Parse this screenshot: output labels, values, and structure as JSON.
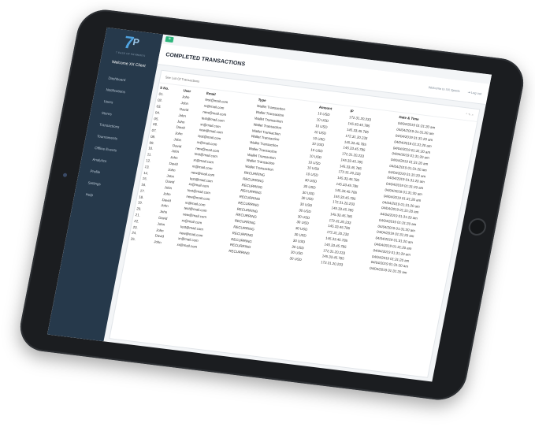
{
  "sidebar": {
    "logo_sub": "7 EASE OF PAYMENTS",
    "welcome": "Welcome XX Client",
    "items": [
      {
        "label": "Dashboard"
      },
      {
        "label": "Notifications"
      },
      {
        "label": "Users"
      },
      {
        "label": "Stores"
      },
      {
        "label": "Transactions"
      },
      {
        "label": "Tournaments"
      },
      {
        "label": "Offline Events"
      },
      {
        "label": "Analytics"
      },
      {
        "label": "Profile"
      },
      {
        "label": "Settings"
      },
      {
        "label": "Help"
      }
    ]
  },
  "header": {
    "title": "COMPLETED TRANSACTIONS",
    "welcome_user": "Welcome to XX Sports",
    "logout": "Log out"
  },
  "card": {
    "title": "See List Of Transactions",
    "tools": "^ ✎ ×"
  },
  "table": {
    "columns": [
      "S No.",
      "User",
      "Email",
      "Type",
      "Amount",
      "IP",
      "Date & Time"
    ],
    "rows": [
      [
        "01.",
        "John",
        "test@mail.com",
        "Wallet Transaction",
        "10 USD",
        "172.31.20.233",
        "04/04/2019 01:31:20 am"
      ],
      [
        "02.",
        "John",
        "xr@mail.com",
        "Wallet Transaction",
        "10 USD",
        "145.33.45.785",
        "04/04/2019 01:31:20 am"
      ],
      [
        "03.",
        "David",
        "new@mail.com",
        "Wallet Transaction",
        "10 USD",
        "145.33.45.785",
        "04/04/2019 01:31:20 am"
      ],
      [
        "04.",
        "John",
        "test@mail.com",
        "Wallet Transaction",
        "10 USD",
        "172.31.20.233",
        "04/04/2019 01:31:20 am"
      ],
      [
        "05.",
        "John",
        "xr@mail.com",
        "Wallet Transaction",
        "10 USD",
        "145.33.45.785",
        "04/04/2019 01:31:20 am"
      ],
      [
        "06.",
        "David",
        "new@mail.com",
        "Wallet Transaction",
        "10 USD",
        "145.33.45.785",
        "04/04/2019 01:31:20 am"
      ],
      [
        "07.",
        "John",
        "test@mail.com",
        "Wallet Transaction",
        "10 USD",
        "172.31.20.233",
        "04/04/2019 01:31:20 am"
      ],
      [
        "08.",
        "John",
        "xr@mail.com",
        "Wallet Transaction",
        "10 USD",
        "145.33.45.785",
        "04/04/2019 01:31:20 am"
      ],
      [
        "09.",
        "David",
        "new@mail.com",
        "Wallet Transaction",
        "10 USD",
        "145.33.45.785",
        "04/04/2019 01:31:20 am"
      ],
      [
        "10.",
        "John",
        "test@mail.com",
        "Wallet Transaction",
        "10 USD",
        "172.31.20.233",
        "04/04/2019 01:31:20 am"
      ],
      [
        "11.",
        "John",
        "xr@mail.com",
        "Wallet Transaction",
        "10 USD",
        "145.33.45.785",
        "04/04/2019 01:31:20 am"
      ],
      [
        "12.",
        "David",
        "xr@mail.com",
        "RECURRING",
        "30 USD",
        "145.33.45.785",
        "04/04/2019 01:31:20 am"
      ],
      [
        "13.",
        "John",
        "new@mail.com",
        "RECURRING",
        "30 USD",
        "145.33.45.785",
        "04/04/2019 01:31:20 am"
      ],
      [
        "14.",
        "John",
        "test@mail.com",
        "RECURRING",
        "30 USD",
        "145.33.45.785",
        "04/04/2019 01:31:20 am"
      ],
      [
        "15.",
        "David",
        "xr@mail.com",
        "RECURRING",
        "30 USD",
        "172.31.20.233",
        "04/04/2019 01:31:20 am"
      ],
      [
        "16.",
        "John",
        "test@mail.com",
        "RECURRING",
        "30 USD",
        "145.33.45.785",
        "04/04/2019 01:31:20 am"
      ],
      [
        "17.",
        "John",
        "new@mail.com",
        "RECURRING",
        "30 USD",
        "145.33.45.785",
        "04/04/2019 01:31:20 am"
      ],
      [
        "18.",
        "David",
        "xr@mail.com",
        "RECURRING",
        "30 USD",
        "172.31.20.233",
        "04/04/2019 01:31:20 am"
      ],
      [
        "19.",
        "John",
        "test@mail.com",
        "RECURRING",
        "30 USD",
        "145.33.45.785",
        "04/04/2019 01:31:20 am"
      ],
      [
        "20.",
        "John",
        "new@mail.com",
        "RECURRING",
        "30 USD",
        "172.31.20.233",
        "04/04/2019 01:31:20 am"
      ],
      [
        "21.",
        "David",
        "xr@mail.com",
        "RECURRING",
        "30 USD",
        "145.33.45.785",
        "04/04/2019 01:31:20 am"
      ],
      [
        "22.",
        "John",
        "test@mail.com",
        "RECURRING",
        "30 USD",
        "145.33.45.785",
        "04/04/2019 01:31:20 am"
      ],
      [
        "23.",
        "John",
        "new@mail.com",
        "RECURRING",
        "30 USD",
        "172.31.20.233",
        "04/04/2019 01:31:20 am"
      ],
      [
        "24.",
        "David",
        "xr@mail.com",
        "RECURRING",
        "30 USD",
        "145.33.45.785",
        "04/04/2019 01:31:20 am"
      ],
      [
        "25.",
        "John",
        "xr@mail.com",
        "RECURRING",
        "30 USD",
        "172.31.20.233",
        "04/04/2019 01:31:20 am"
      ]
    ]
  },
  "colors": {
    "sidebar_bg": "#26394b",
    "accent": "#2db57b",
    "brand_blue": "#4fa3e0"
  }
}
